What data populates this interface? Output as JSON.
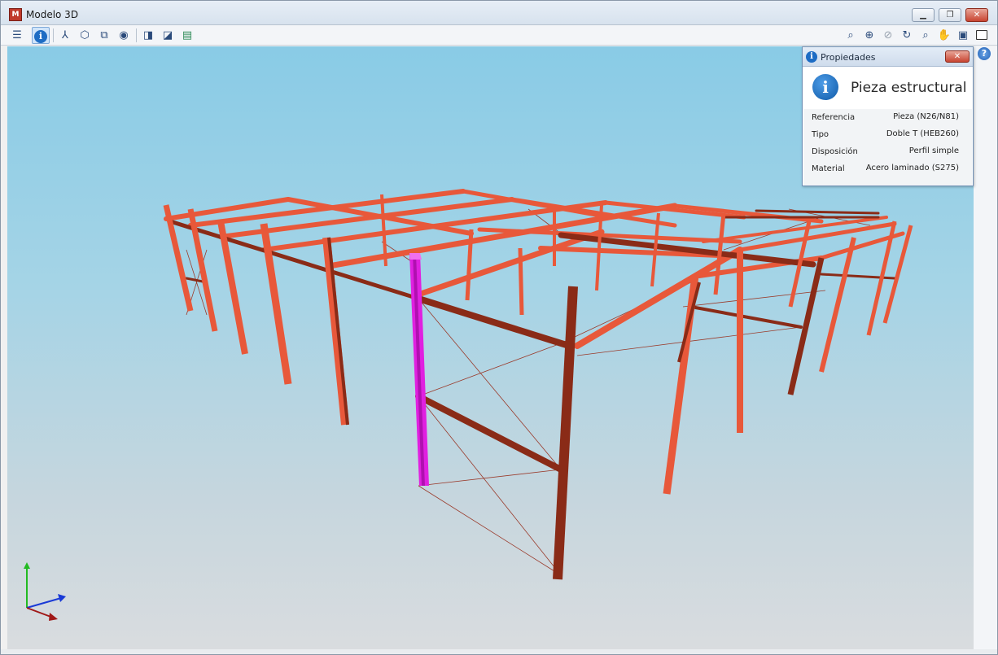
{
  "window": {
    "title": "Modelo 3D",
    "app_icon": "app-logo-icon",
    "controls": {
      "minimize": "minimize-icon",
      "restore": "restore-icon",
      "close": "close-icon"
    }
  },
  "toolbar": {
    "left": [
      {
        "name": "layers-button",
        "icon": "layers-icon",
        "glyph": "☰"
      },
      {
        "name": "info-button",
        "icon": "info-icon",
        "glyph": "i",
        "active": true
      },
      {
        "name": "axes-button",
        "icon": "axes-icon",
        "glyph": "⅄"
      },
      {
        "name": "solid-view-button",
        "icon": "cube-icon",
        "glyph": "⬡"
      },
      {
        "name": "wire-view-button",
        "icon": "wire-cube-icon",
        "glyph": "⧉"
      },
      {
        "name": "render-button",
        "icon": "eye-icon",
        "glyph": "◉"
      },
      {
        "name": "section-view-button",
        "icon": "section-icon",
        "glyph": "◨"
      },
      {
        "name": "plane-view-button",
        "icon": "plane-icon",
        "glyph": "◪"
      },
      {
        "name": "floor-view-button",
        "icon": "floor-icon",
        "glyph": "▤"
      }
    ],
    "right": [
      {
        "name": "zoom-window-button",
        "icon": "zoom-window-icon",
        "glyph": "⌕"
      },
      {
        "name": "zoom-all-button",
        "icon": "zoom-all-icon",
        "glyph": "⊕"
      },
      {
        "name": "zoom-prev-button",
        "icon": "zoom-prev-icon",
        "glyph": "⊘"
      },
      {
        "name": "rotate-button",
        "icon": "rotate-icon",
        "glyph": "↻"
      },
      {
        "name": "zoom-button",
        "icon": "magnifier-icon",
        "glyph": "⌕"
      },
      {
        "name": "pan-button",
        "icon": "hand-icon",
        "glyph": "✋"
      },
      {
        "name": "view-select-button",
        "icon": "view-select-icon",
        "glyph": "▣"
      },
      {
        "name": "book-button",
        "icon": "book-icon",
        "glyph": "📖"
      }
    ]
  },
  "properties_panel": {
    "title": "Propiedades",
    "heading": "Pieza estructural",
    "rows": [
      {
        "key": "Referencia",
        "value": "Pieza (N26/N81)"
      },
      {
        "key": "Tipo",
        "value": "Doble T (HEB260)"
      },
      {
        "key": "Disposición",
        "value": "Perfil simple"
      },
      {
        "key": "Material",
        "value": "Acero laminado (S275)"
      }
    ]
  },
  "help": {
    "glyph": "?",
    "icon": "help-icon"
  },
  "colors": {
    "steel_light": "#e8583a",
    "steel_dark": "#8a2b17",
    "selected": "#e020e0",
    "bracing": "#9a3a2a"
  }
}
